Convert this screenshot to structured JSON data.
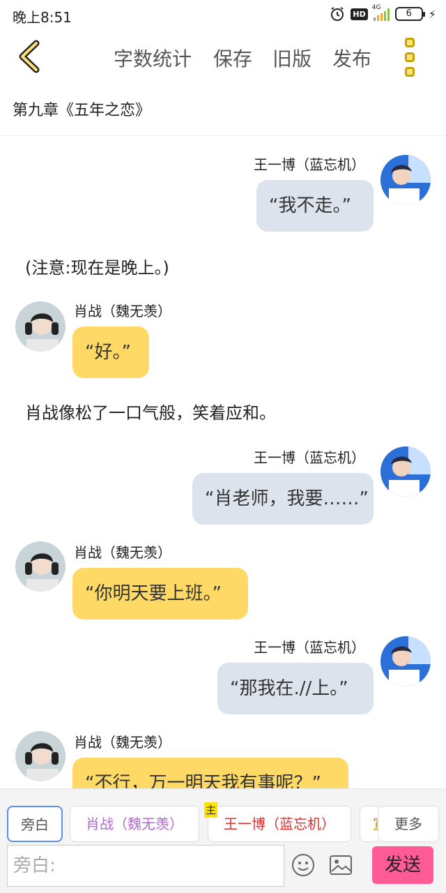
{
  "status": {
    "time": "晚上8:51",
    "hd": "HD",
    "network": "4G",
    "battery": "6"
  },
  "toolbar": {
    "word_count": "字数统计",
    "save": "保存",
    "old_version": "旧版",
    "publish": "发布"
  },
  "chapter_title": "第九章《五年之恋》",
  "messages": [
    {
      "side": "right",
      "name": "王一博（蓝忘机）",
      "text": "“我不走。”"
    },
    {
      "side": "narration",
      "text": "(注意:现在是晚上。)"
    },
    {
      "side": "left",
      "name": "肖战（魏无羡）",
      "text": "“好。”"
    },
    {
      "side": "narration",
      "text": "肖战像松了一口气般，笑着应和。"
    },
    {
      "side": "right",
      "name": "王一博（蓝忘机）",
      "text": "“肖老师，我要……”"
    },
    {
      "side": "left",
      "name": "肖战（魏无羡）",
      "text": "“你明天要上班。”"
    },
    {
      "side": "right",
      "name": "王一博（蓝忘机）",
      "text": "“那我在.//上。”"
    },
    {
      "side": "left",
      "name": "肖战（魏无羡）",
      "text": "“不行，万一明天我有事呢？”"
    }
  ],
  "roles": {
    "narrator": "旁白",
    "xiao": "肖战（魏无羡）",
    "main_badge": "主",
    "wang": "王一博（蓝忘机）",
    "partial": "宣",
    "more": "更多"
  },
  "input": {
    "placeholder": "旁白:"
  },
  "send": "发送",
  "colors": {
    "accent": "#ffd966",
    "send": "#ff5c96",
    "right_bubble": "#dde3ec"
  }
}
